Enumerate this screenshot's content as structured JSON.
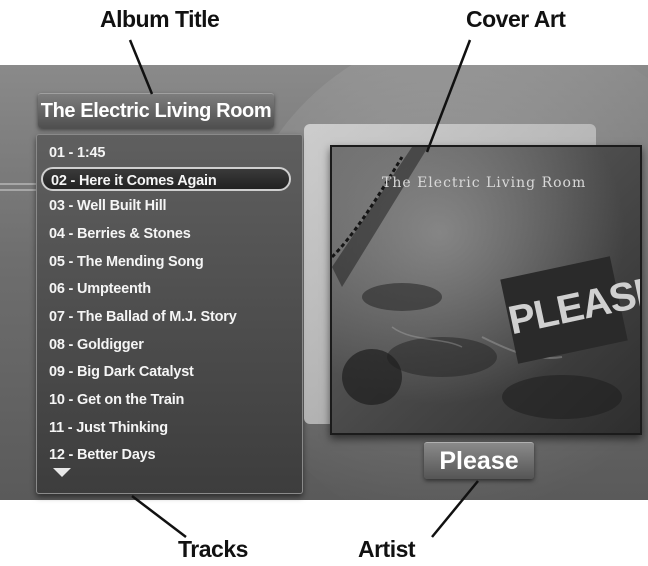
{
  "callouts": {
    "album_title": "Album Title",
    "cover_art": "Cover Art",
    "tracks": "Tracks",
    "artist": "Artist"
  },
  "album": {
    "title": "The Electric Living Room"
  },
  "tracks": {
    "selected_index": 1,
    "items": [
      {
        "label": "01 - 1:45"
      },
      {
        "label": "02 - Here it Comes Again"
      },
      {
        "label": "03 - Well Built Hill"
      },
      {
        "label": "04 - Berries & Stones"
      },
      {
        "label": "05 - The Mending Song"
      },
      {
        "label": "06 - Umpteenth"
      },
      {
        "label": "07 - The Ballad of M.J. Story"
      },
      {
        "label": "08 - Goldigger"
      },
      {
        "label": "09 - Big Dark Catalyst"
      },
      {
        "label": "10 - Get on the Train"
      },
      {
        "label": "11 - Just Thinking"
      },
      {
        "label": "12 - Better Days"
      }
    ],
    "scroll_icon": "triangle-down-icon"
  },
  "cover": {
    "title": "The Electric Living Room",
    "word": "PLEASE"
  },
  "artist": {
    "name": "Please"
  },
  "colors": {
    "panel": "#4a4a4a",
    "text": "#ffffff",
    "selection_border": "#cfcfcf"
  }
}
